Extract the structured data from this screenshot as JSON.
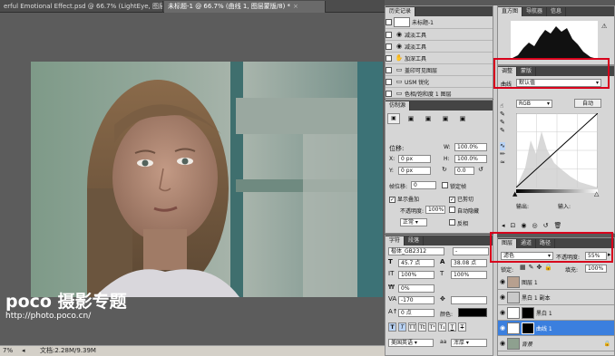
{
  "doc_tabs": [
    {
      "label": "erful Emotional Effect.psd @ 66.7% (LightEye, 图层蒙版/8) *",
      "active": false
    },
    {
      "label": "未标题-1 @ 66.7% (曲线 1, 图层蒙版/8) *",
      "active": true
    }
  ],
  "watermark": {
    "brand": "poco 摄影专题",
    "url": "http://photo.poco.cn/"
  },
  "status_bar": {
    "zoom": "7%",
    "doc_size": "文档:2.28M/9.39M"
  },
  "history": {
    "tabs": [
      "历史记录"
    ],
    "snapshot": "未标题-1",
    "items": [
      "减淡工具",
      "减淡工具",
      "加深工具",
      "盖印可见图层",
      "USM 锐化",
      "色相/饱和度 1 图层"
    ]
  },
  "histogram": {
    "tabs": [
      "直方图",
      "导航器",
      "信息"
    ]
  },
  "adjustments": {
    "tabs": [
      "调整",
      "蒙版"
    ],
    "preset_label": "曲线",
    "preset_value": "默认值",
    "channel": "RGB",
    "auto_button": "自动",
    "output_label": "输出:",
    "input_label": "输入:"
  },
  "transform": {
    "tab": "仿制源",
    "offset_label": "位移:",
    "x_label": "X:",
    "x_value": "0 px",
    "y_label": "Y:",
    "y_value": "0 px",
    "w_label": "W:",
    "w_value": "100.0%",
    "h_label": "H:",
    "h_value": "100.0%",
    "angle_value": "0.0",
    "frame_offset_label": "帧位移:",
    "frame_offset_value": "0",
    "lock_frame_label": "锁定帧",
    "show_overlay_label": "显示叠加",
    "clipped_label": "已剪切",
    "opacity_label": "不透明度:",
    "opacity_value": "100%",
    "auto_hide_label": "自动隐藏",
    "blend_value": "正常",
    "invert_label": "反相"
  },
  "character": {
    "tabs": [
      "字符",
      "段落"
    ],
    "font_family": "楷体_GB2312",
    "font_style": "-",
    "font_size": "45.7 点",
    "leading": "38.08 点",
    "vscale": "100%",
    "hscale": "100%",
    "tracking": "0%",
    "kerning": "-170",
    "baseline": "0 点",
    "color_label": "颜色:",
    "language": "美国英语",
    "aa_symbol": "aa",
    "antialias": "浑厚"
  },
  "layers": {
    "tabs": [
      "图层",
      "通道",
      "路径"
    ],
    "blend_mode": "滤色",
    "opacity_label": "不透明度:",
    "opacity_value": "55%",
    "lock_label": "锁定:",
    "fill_label": "填充:",
    "fill_value": "100%",
    "rows": [
      {
        "name": "图层 1",
        "selected": false,
        "mask": false
      },
      {
        "name": "黑白 1 副本",
        "selected": false,
        "mask": false
      },
      {
        "name": "黑白 1",
        "selected": false,
        "mask": true
      },
      {
        "name": "曲线 1",
        "selected": true,
        "mask": true
      },
      {
        "name": "背景",
        "selected": false,
        "mask": false
      }
    ]
  },
  "colors": {
    "accent_red": "#d8001c",
    "selection_blue": "#3b7fde"
  }
}
